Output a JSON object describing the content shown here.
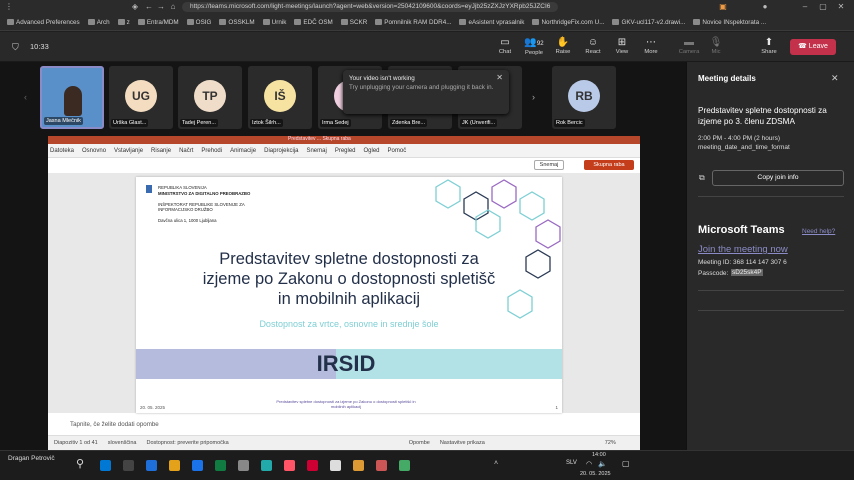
{
  "browser": {
    "url": "https://teams.microsoft.com/light-meetings/launch?agent=web&version=25042109600&coords=eyJjb25zZXJzYXRpb25JZCI6",
    "bookmarks": [
      "Advanced Preferences",
      "Arch",
      "z",
      "Entra/MDM",
      "OSIG",
      "OSSKLM",
      "Urnik",
      "EDČ OSM",
      "SCKR",
      "Pomnilnik RAM DDR4...",
      "eAsistent vprasalnik",
      "NorthridgeFix.com U...",
      "GKV-ucl117-v2.drawi...",
      "Novice INspektorata ..."
    ]
  },
  "meeting": {
    "timer": "10:33",
    "people_count": "92",
    "toolbar": {
      "chat": "Chat",
      "people": "People",
      "raise": "Raise",
      "react": "React",
      "view": "View",
      "more": "More",
      "camera": "Camera",
      "mic": "Mic",
      "share": "Share",
      "leave": "Leave"
    }
  },
  "participants": [
    {
      "name": "Jasna Mlečnik",
      "initials": "",
      "color": "#5a90c9"
    },
    {
      "name": "Urška Glast...",
      "initials": "UG",
      "color": "#f3dcc0"
    },
    {
      "name": "Tadej Peren...",
      "initials": "TP",
      "color": "#f0ddc9"
    },
    {
      "name": "Iztok Šilrh...",
      "initials": "IŠ",
      "color": "#f6e3a2"
    },
    {
      "name": "Irma Sedej",
      "initials": "",
      "color": "#f0d0e0"
    },
    {
      "name": "Zdenka Bre...",
      "initials": "",
      "color": "#2b2b2b"
    },
    {
      "name": "JK (Unverifi...",
      "initials": "",
      "color": "#2b2b2b"
    },
    {
      "name": "Rok Bercic",
      "initials": "RB",
      "color": "#b9c9e8"
    }
  ],
  "toast": {
    "title": "Your video isn't working",
    "body": "Try unplugging your camera and plugging it back in."
  },
  "ppt": {
    "title": "Predstavitev ... Skupna raba",
    "tabs": [
      "Datoteka",
      "Osnovno",
      "Vstavljanje",
      "Risanje",
      "Načrt",
      "Prehodi",
      "Animacije",
      "Diaprojekcija",
      "Snemaj",
      "Pregled",
      "Ogled",
      "Pomoč"
    ],
    "record_label": "Snemaj",
    "share_label": "Skupna raba",
    "slide": {
      "org1": "REPUBLIKA SLOVENIJA",
      "org2": "MINISTRSTVO ZA DIGITALNO PREOBRAZBO",
      "org3": "INŠPEKTORAT REPUBLIKE SLOVENIJE ZA",
      "org4": "INFORMACIJSKO DRUŽBO",
      "address": "Davčna ulica 1, 1000 Ljubljana",
      "title": "Predstavitev spletne dostopnosti za izjeme po Zakonu o dostopnosti spletišč in mobilnih aplikacij",
      "subtitle": "Dostopnost za vrtce, osnovne in srednje šole",
      "logo": "IRSID",
      "logo_caption": "Predstavitev spletne dostopnosti za izjeme po Zakonu o dostopnosti spletišč in mobilnih aplikacij",
      "date": "20. 05. 2025",
      "page": "1"
    },
    "notes": "Tapnite, če želite dodati opombe",
    "status_slide": "Diapozitiv 1 od 41",
    "status_lang": "slovenščina",
    "status_access": "Dostopnost: preverite pripomočka",
    "status_notes": "Opombe",
    "status_display": "Nastavitve prikaza",
    "zoom": "72%"
  },
  "panel": {
    "header": "Meeting details",
    "meeting_title": "Predstavitev spletne dostopnosti za izjeme po 3. členu ZDSMA",
    "time": "2:00 PM - 4:00 PM (2 hours)",
    "time_fmt": "meeting_date_and_time_format",
    "copy": "Copy join info",
    "ms_teams": "Microsoft Teams",
    "need_help": "Need help?",
    "join": "Join the meeting now",
    "meeting_id": "Meeting ID: 368 114 147 307 6",
    "passcode_label": "Passcode:",
    "passcode": "sD25sk4P"
  },
  "taskbar": {
    "user": "Dragan Petrovič",
    "lang": "SLV",
    "time": "14:00",
    "date": "20. 05. 2025"
  }
}
